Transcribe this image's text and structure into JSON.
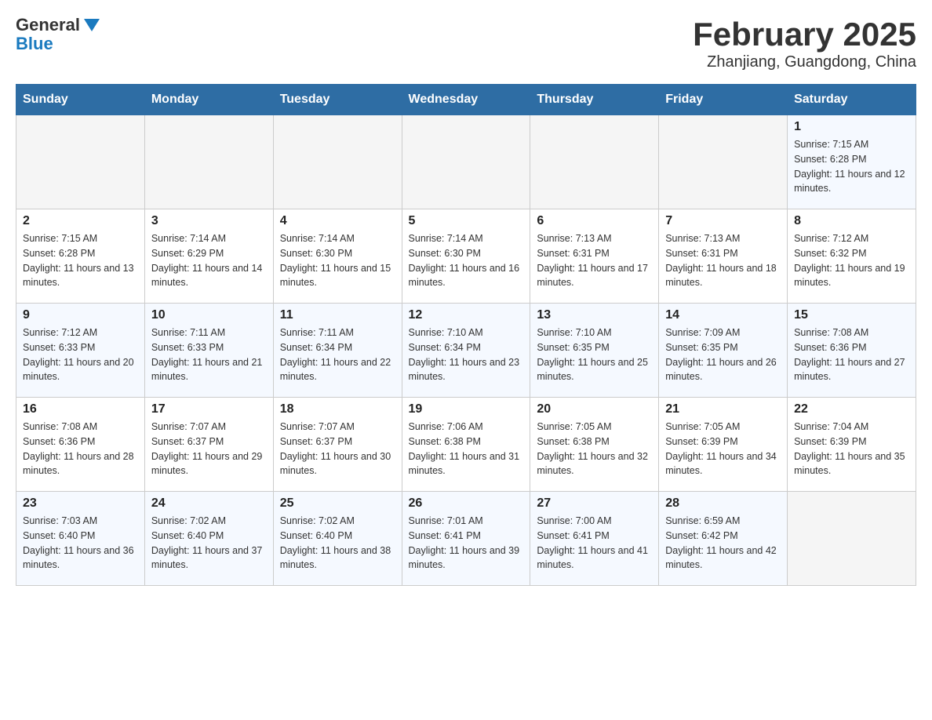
{
  "header": {
    "logo_general": "General",
    "logo_blue": "Blue",
    "month_title": "February 2025",
    "location": "Zhanjiang, Guangdong, China"
  },
  "weekdays": [
    "Sunday",
    "Monday",
    "Tuesday",
    "Wednesday",
    "Thursday",
    "Friday",
    "Saturday"
  ],
  "weeks": [
    [
      {
        "day": "",
        "sunrise": "",
        "sunset": "",
        "daylight": ""
      },
      {
        "day": "",
        "sunrise": "",
        "sunset": "",
        "daylight": ""
      },
      {
        "day": "",
        "sunrise": "",
        "sunset": "",
        "daylight": ""
      },
      {
        "day": "",
        "sunrise": "",
        "sunset": "",
        "daylight": ""
      },
      {
        "day": "",
        "sunrise": "",
        "sunset": "",
        "daylight": ""
      },
      {
        "day": "",
        "sunrise": "",
        "sunset": "",
        "daylight": ""
      },
      {
        "day": "1",
        "sunrise": "Sunrise: 7:15 AM",
        "sunset": "Sunset: 6:28 PM",
        "daylight": "Daylight: 11 hours and 12 minutes."
      }
    ],
    [
      {
        "day": "2",
        "sunrise": "Sunrise: 7:15 AM",
        "sunset": "Sunset: 6:28 PM",
        "daylight": "Daylight: 11 hours and 13 minutes."
      },
      {
        "day": "3",
        "sunrise": "Sunrise: 7:14 AM",
        "sunset": "Sunset: 6:29 PM",
        "daylight": "Daylight: 11 hours and 14 minutes."
      },
      {
        "day": "4",
        "sunrise": "Sunrise: 7:14 AM",
        "sunset": "Sunset: 6:30 PM",
        "daylight": "Daylight: 11 hours and 15 minutes."
      },
      {
        "day": "5",
        "sunrise": "Sunrise: 7:14 AM",
        "sunset": "Sunset: 6:30 PM",
        "daylight": "Daylight: 11 hours and 16 minutes."
      },
      {
        "day": "6",
        "sunrise": "Sunrise: 7:13 AM",
        "sunset": "Sunset: 6:31 PM",
        "daylight": "Daylight: 11 hours and 17 minutes."
      },
      {
        "day": "7",
        "sunrise": "Sunrise: 7:13 AM",
        "sunset": "Sunset: 6:31 PM",
        "daylight": "Daylight: 11 hours and 18 minutes."
      },
      {
        "day": "8",
        "sunrise": "Sunrise: 7:12 AM",
        "sunset": "Sunset: 6:32 PM",
        "daylight": "Daylight: 11 hours and 19 minutes."
      }
    ],
    [
      {
        "day": "9",
        "sunrise": "Sunrise: 7:12 AM",
        "sunset": "Sunset: 6:33 PM",
        "daylight": "Daylight: 11 hours and 20 minutes."
      },
      {
        "day": "10",
        "sunrise": "Sunrise: 7:11 AM",
        "sunset": "Sunset: 6:33 PM",
        "daylight": "Daylight: 11 hours and 21 minutes."
      },
      {
        "day": "11",
        "sunrise": "Sunrise: 7:11 AM",
        "sunset": "Sunset: 6:34 PM",
        "daylight": "Daylight: 11 hours and 22 minutes."
      },
      {
        "day": "12",
        "sunrise": "Sunrise: 7:10 AM",
        "sunset": "Sunset: 6:34 PM",
        "daylight": "Daylight: 11 hours and 23 minutes."
      },
      {
        "day": "13",
        "sunrise": "Sunrise: 7:10 AM",
        "sunset": "Sunset: 6:35 PM",
        "daylight": "Daylight: 11 hours and 25 minutes."
      },
      {
        "day": "14",
        "sunrise": "Sunrise: 7:09 AM",
        "sunset": "Sunset: 6:35 PM",
        "daylight": "Daylight: 11 hours and 26 minutes."
      },
      {
        "day": "15",
        "sunrise": "Sunrise: 7:08 AM",
        "sunset": "Sunset: 6:36 PM",
        "daylight": "Daylight: 11 hours and 27 minutes."
      }
    ],
    [
      {
        "day": "16",
        "sunrise": "Sunrise: 7:08 AM",
        "sunset": "Sunset: 6:36 PM",
        "daylight": "Daylight: 11 hours and 28 minutes."
      },
      {
        "day": "17",
        "sunrise": "Sunrise: 7:07 AM",
        "sunset": "Sunset: 6:37 PM",
        "daylight": "Daylight: 11 hours and 29 minutes."
      },
      {
        "day": "18",
        "sunrise": "Sunrise: 7:07 AM",
        "sunset": "Sunset: 6:37 PM",
        "daylight": "Daylight: 11 hours and 30 minutes."
      },
      {
        "day": "19",
        "sunrise": "Sunrise: 7:06 AM",
        "sunset": "Sunset: 6:38 PM",
        "daylight": "Daylight: 11 hours and 31 minutes."
      },
      {
        "day": "20",
        "sunrise": "Sunrise: 7:05 AM",
        "sunset": "Sunset: 6:38 PM",
        "daylight": "Daylight: 11 hours and 32 minutes."
      },
      {
        "day": "21",
        "sunrise": "Sunrise: 7:05 AM",
        "sunset": "Sunset: 6:39 PM",
        "daylight": "Daylight: 11 hours and 34 minutes."
      },
      {
        "day": "22",
        "sunrise": "Sunrise: 7:04 AM",
        "sunset": "Sunset: 6:39 PM",
        "daylight": "Daylight: 11 hours and 35 minutes."
      }
    ],
    [
      {
        "day": "23",
        "sunrise": "Sunrise: 7:03 AM",
        "sunset": "Sunset: 6:40 PM",
        "daylight": "Daylight: 11 hours and 36 minutes."
      },
      {
        "day": "24",
        "sunrise": "Sunrise: 7:02 AM",
        "sunset": "Sunset: 6:40 PM",
        "daylight": "Daylight: 11 hours and 37 minutes."
      },
      {
        "day": "25",
        "sunrise": "Sunrise: 7:02 AM",
        "sunset": "Sunset: 6:40 PM",
        "daylight": "Daylight: 11 hours and 38 minutes."
      },
      {
        "day": "26",
        "sunrise": "Sunrise: 7:01 AM",
        "sunset": "Sunset: 6:41 PM",
        "daylight": "Daylight: 11 hours and 39 minutes."
      },
      {
        "day": "27",
        "sunrise": "Sunrise: 7:00 AM",
        "sunset": "Sunset: 6:41 PM",
        "daylight": "Daylight: 11 hours and 41 minutes."
      },
      {
        "day": "28",
        "sunrise": "Sunrise: 6:59 AM",
        "sunset": "Sunset: 6:42 PM",
        "daylight": "Daylight: 11 hours and 42 minutes."
      },
      {
        "day": "",
        "sunrise": "",
        "sunset": "",
        "daylight": ""
      }
    ]
  ]
}
